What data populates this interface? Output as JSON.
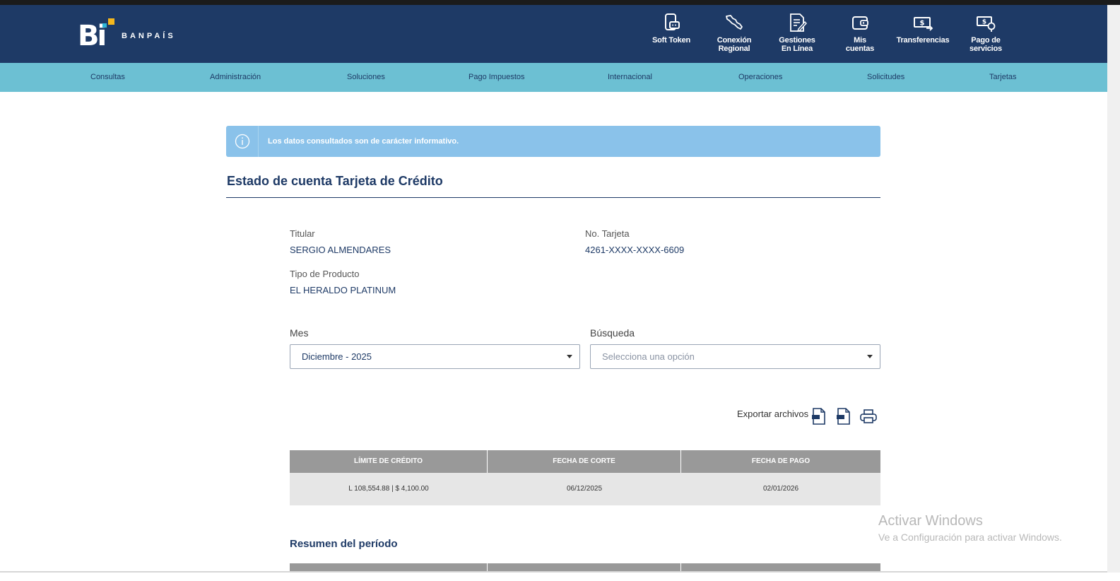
{
  "brand": {
    "logo_mark": "Bi",
    "name": "BANPAÍS"
  },
  "quick_links": [
    {
      "label": "Soft Token",
      "icon": "soft-token-icon"
    },
    {
      "label": "Conexión\nRegional",
      "icon": "regional-map-icon"
    },
    {
      "label": "Gestiones\nEn Línea",
      "icon": "document-edit-icon"
    },
    {
      "label": "Mis\ncuentas",
      "icon": "wallet-icon"
    },
    {
      "label": "Transferencias",
      "icon": "money-transfer-icon"
    },
    {
      "label": "Pago de\nservicios",
      "icon": "bill-payment-icon"
    }
  ],
  "nav": [
    "Consultas",
    "Administración",
    "Soluciones",
    "Pago Impuestos",
    "Internacional",
    "Operaciones",
    "Solicitudes",
    "Tarjetas"
  ],
  "alert": {
    "text": "Los datos consultados son de carácter informativo."
  },
  "page_title": "Estado de cuenta Tarjeta de Crédito",
  "details": {
    "holder_label": "Titular",
    "holder_value": "SERGIO ALMENDARES",
    "card_label": "No. Tarjeta",
    "card_value": "4261-XXXX-XXXX-6609",
    "product_label": "Tipo de Producto",
    "product_value": "EL HERALDO PLATINUM"
  },
  "filters": {
    "month_label": "Mes",
    "month_value": "Diciembre - 2025",
    "search_label": "Búsqueda",
    "search_placeholder": "Selecciona una opción"
  },
  "export": {
    "label": "Exportar archivos"
  },
  "summary_table": {
    "headers": [
      "LÍMITE DE CRÉDITO",
      "FECHA DE CORTE",
      "FECHA DE PAGO"
    ],
    "row": [
      "L 108,554.88 | $ 4,100.00",
      "06/12/2025",
      "02/01/2026"
    ]
  },
  "period_title": "Resumen del período",
  "watermark": {
    "title": "Activar Windows",
    "subtitle": "Ve a Configuración para activar Windows."
  },
  "colors": {
    "header": "#1e3a66",
    "nav": "#6cc0d3",
    "alert": "#8ac2ea",
    "table_head": "#999999",
    "table_row": "#e6e6e6",
    "logo_accent": "#f5b71d"
  }
}
